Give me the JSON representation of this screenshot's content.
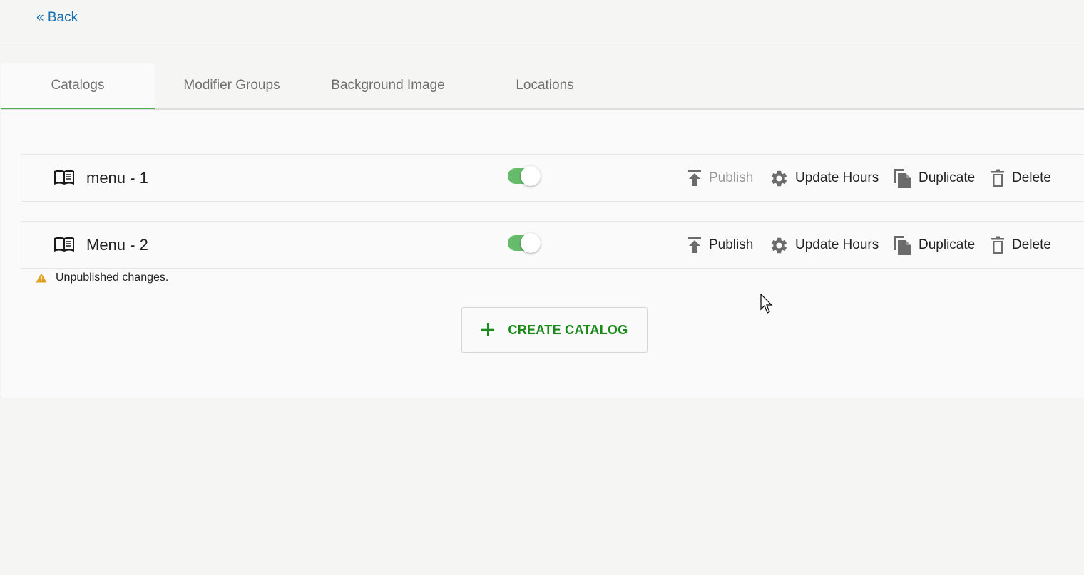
{
  "header": {
    "back_label": "« Back"
  },
  "tabs": [
    {
      "label": "Catalogs",
      "active": true
    },
    {
      "label": "Modifier Groups",
      "active": false
    },
    {
      "label": "Background Image",
      "active": false
    },
    {
      "label": "Locations",
      "active": false
    }
  ],
  "catalogs": [
    {
      "name": "menu - 1",
      "enabled": true,
      "actions": {
        "publish": "Publish",
        "update_hours": "Update Hours",
        "duplicate": "Duplicate",
        "delete": "Delete"
      },
      "publish_disabled": true
    },
    {
      "name": "Menu - 2",
      "enabled": true,
      "actions": {
        "publish": "Publish",
        "update_hours": "Update Hours",
        "duplicate": "Duplicate",
        "delete": "Delete"
      },
      "publish_disabled": false
    }
  ],
  "warning": {
    "text": "Unpublished changes.",
    "icon": "warning-icon",
    "color": "#e0a020"
  },
  "create_button": {
    "label": "CREATE CATALOG",
    "icon": "plus-icon",
    "color": "#1b8a1b"
  },
  "colors": {
    "accent": "#4caf50",
    "toggle_on": "#66bb6a",
    "link": "#1a6fb0"
  }
}
